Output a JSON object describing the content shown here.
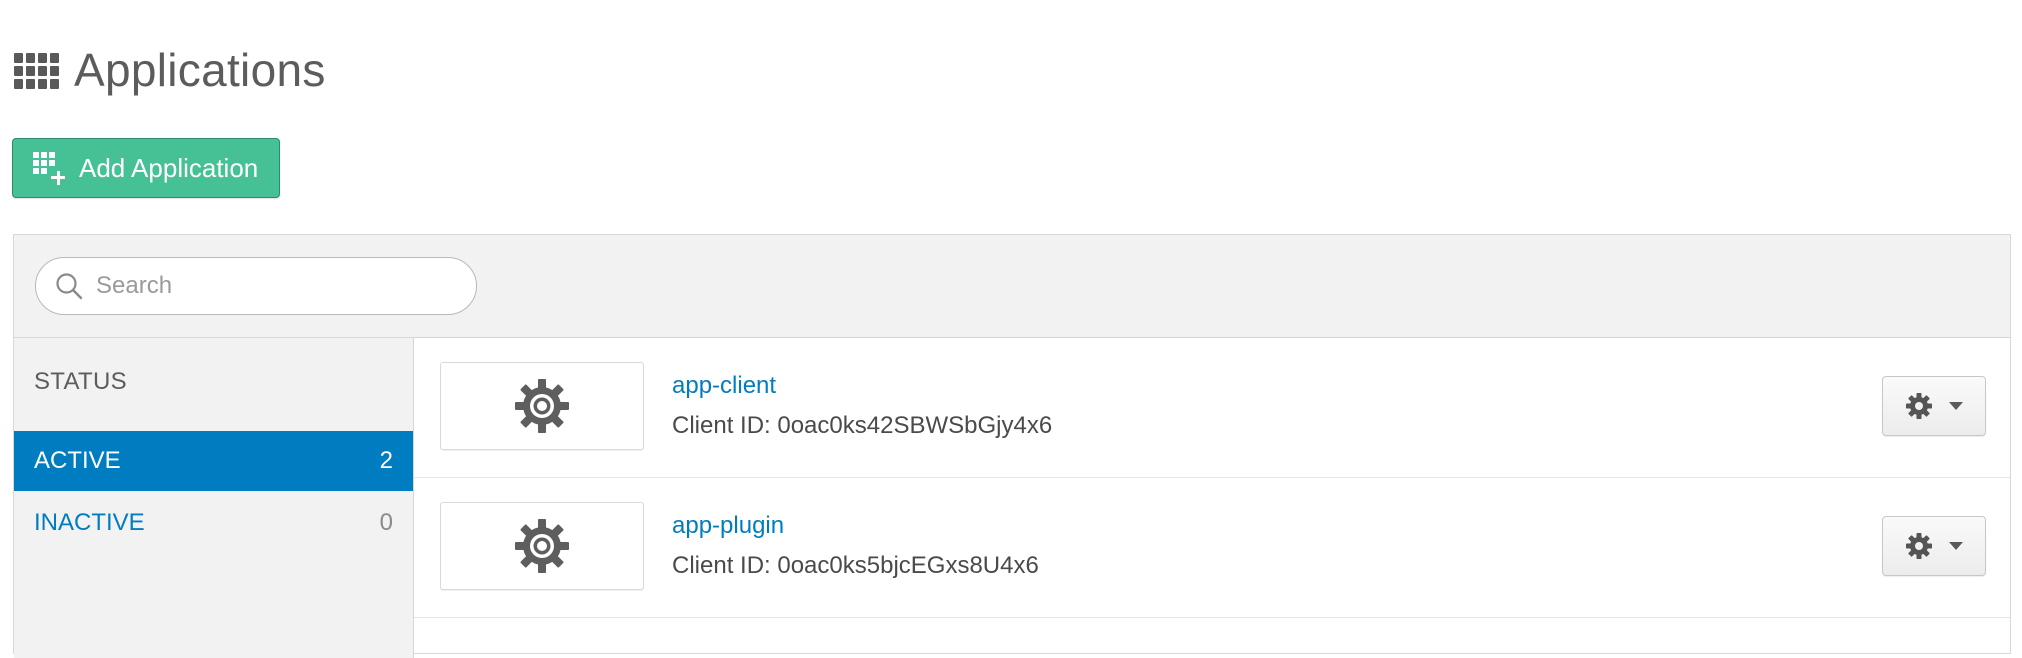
{
  "header": {
    "title": "Applications",
    "icon": "grid-icon"
  },
  "toolbar": {
    "add_label": "Add Application",
    "add_icon": "add-application-icon",
    "accent_color": "#46c195"
  },
  "search": {
    "placeholder": "Search",
    "value": ""
  },
  "sidebar": {
    "heading": "STATUS",
    "filters": [
      {
        "label": "ACTIVE",
        "count": "2",
        "selected": true
      },
      {
        "label": "INACTIVE",
        "count": "0",
        "selected": false
      }
    ],
    "selected_color": "#007dc1"
  },
  "apps": [
    {
      "name": "app-client",
      "client_id": "Client ID: 0oac0ks42SBWSbGjy4x6",
      "logo_icon": "gear-icon"
    },
    {
      "name": "app-plugin",
      "client_id": "Client ID: 0oac0ks5bjcEGxs8U4x6",
      "logo_icon": "gear-icon"
    }
  ]
}
